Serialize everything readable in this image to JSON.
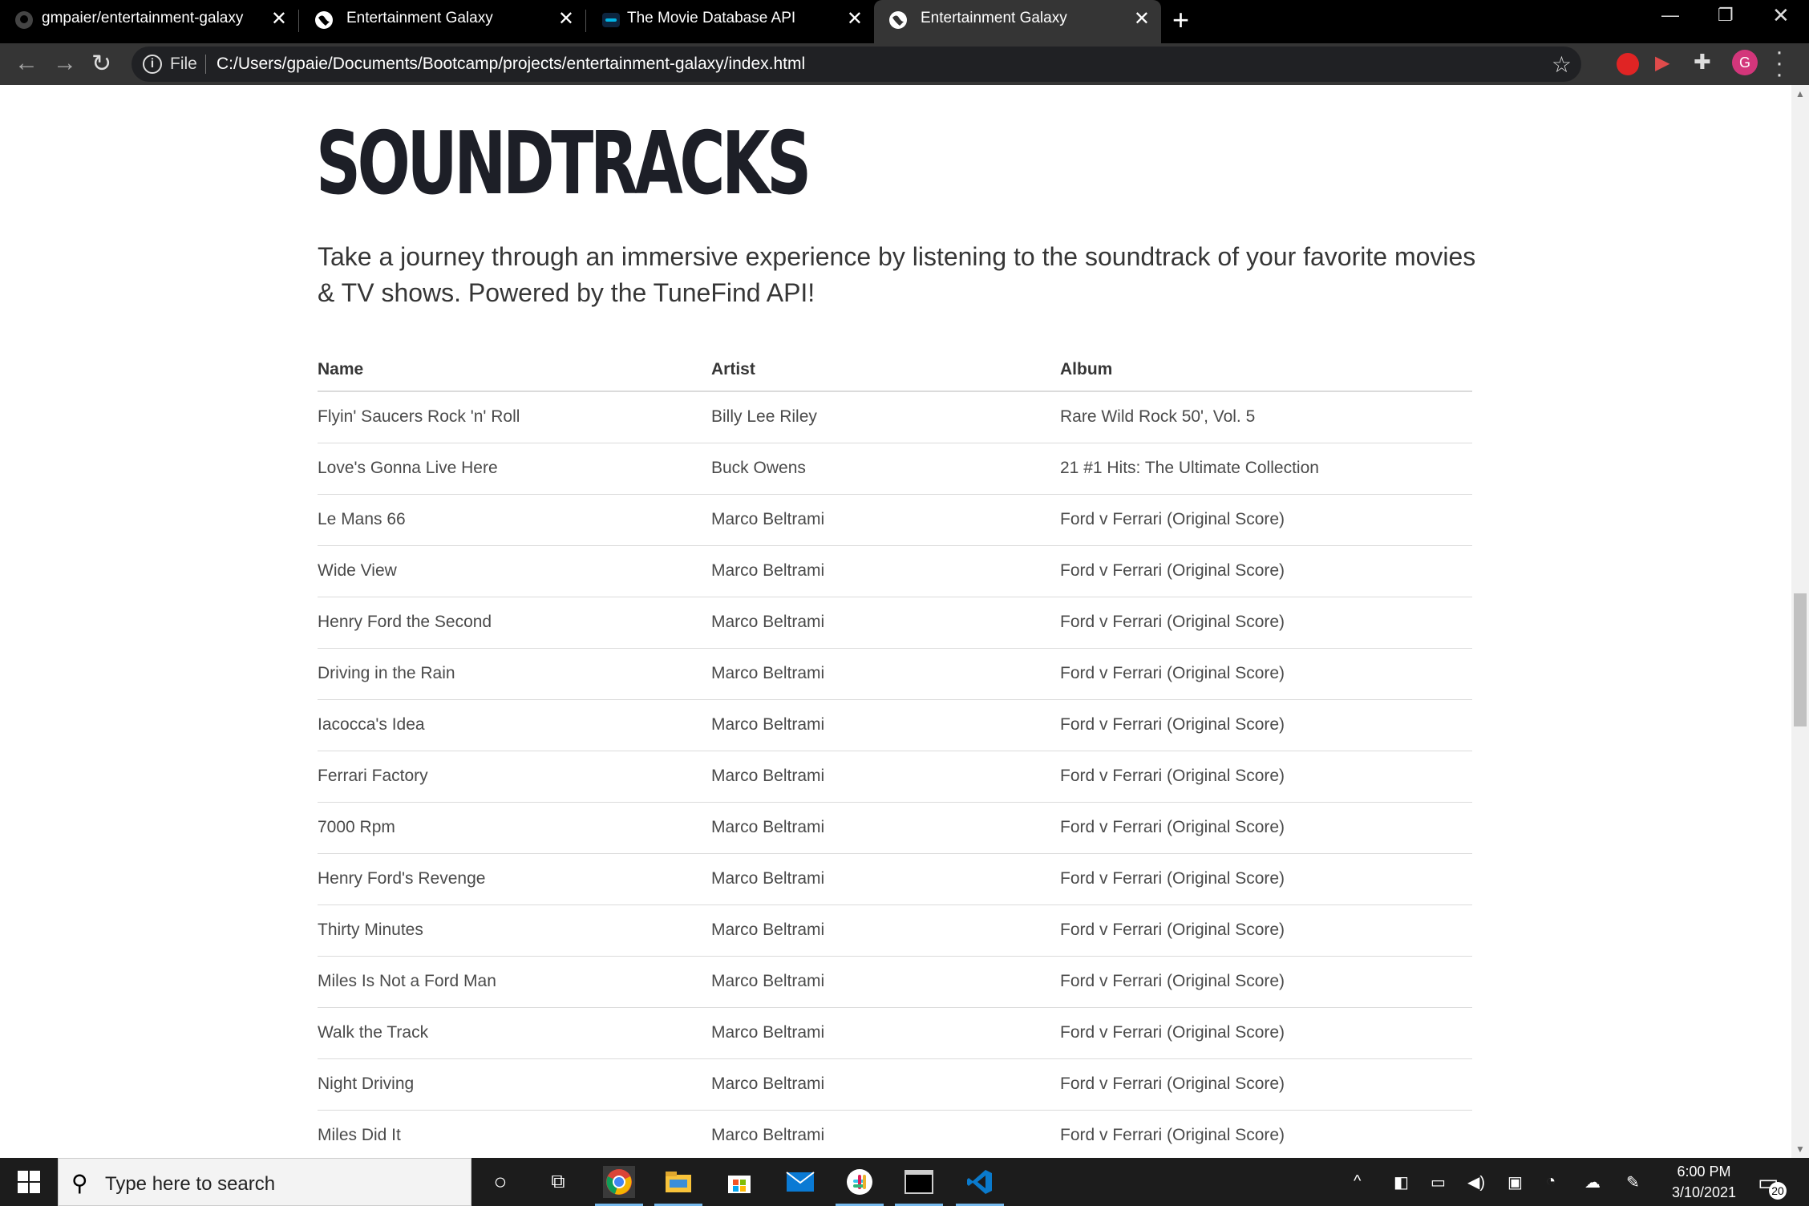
{
  "browser": {
    "tabs": [
      {
        "title": "gmpaier/entertainment-galaxy",
        "icon": "github-icon"
      },
      {
        "title": "Entertainment Galaxy",
        "icon": "globe-icon"
      },
      {
        "title": "The Movie Database API",
        "icon": "tmdb-icon"
      },
      {
        "title": "Entertainment Galaxy",
        "icon": "globe-icon",
        "active": true
      }
    ],
    "new_tab": "+",
    "address": {
      "scheme": "File",
      "url": "C:/Users/gpaie/Documents/Bootcamp/projects/entertainment-galaxy/index.html"
    },
    "profile_initial": "G"
  },
  "page": {
    "title": "SOUNDTRACKS",
    "subtitle": "Take a journey through an immersive experience by listening to the soundtrack of your favorite movies & TV shows. Powered by the TuneFind API!",
    "table": {
      "headers": [
        "Name",
        "Artist",
        "Album"
      ],
      "rows": [
        [
          "Flyin' Saucers Rock 'n' Roll",
          "Billy Lee Riley",
          "Rare Wild Rock 50', Vol. 5"
        ],
        [
          "Love's Gonna Live Here",
          "Buck Owens",
          "21 #1 Hits: The Ultimate Collection"
        ],
        [
          "Le Mans 66",
          "Marco Beltrami",
          "Ford v Ferrari (Original Score)"
        ],
        [
          "Wide View",
          "Marco Beltrami",
          "Ford v Ferrari (Original Score)"
        ],
        [
          "Henry Ford the Second",
          "Marco Beltrami",
          "Ford v Ferrari (Original Score)"
        ],
        [
          "Driving in the Rain",
          "Marco Beltrami",
          "Ford v Ferrari (Original Score)"
        ],
        [
          "Iacocca's Idea",
          "Marco Beltrami",
          "Ford v Ferrari (Original Score)"
        ],
        [
          "Ferrari Factory",
          "Marco Beltrami",
          "Ford v Ferrari (Original Score)"
        ],
        [
          "7000 Rpm",
          "Marco Beltrami",
          "Ford v Ferrari (Original Score)"
        ],
        [
          "Henry Ford's Revenge",
          "Marco Beltrami",
          "Ford v Ferrari (Original Score)"
        ],
        [
          "Thirty Minutes",
          "Marco Beltrami",
          "Ford v Ferrari (Original Score)"
        ],
        [
          "Miles Is Not a Ford Man",
          "Marco Beltrami",
          "Ford v Ferrari (Original Score)"
        ],
        [
          "Walk the Track",
          "Marco Beltrami",
          "Ford v Ferrari (Original Score)"
        ],
        [
          "Night Driving",
          "Marco Beltrami",
          "Ford v Ferrari (Original Score)"
        ],
        [
          "Miles Did It",
          "Marco Beltrami",
          "Ford v Ferrari (Original Score)"
        ]
      ]
    }
  },
  "taskbar": {
    "search_placeholder": "Type here to search",
    "time": "6:00 PM",
    "date": "3/10/2021",
    "notification_count": "20"
  },
  "colors": {
    "title": "#1d1f27",
    "text": "#4a4a4a",
    "tab_bar": "#000000",
    "toolbar": "#353535",
    "taskbar": "#1c1c1c"
  }
}
